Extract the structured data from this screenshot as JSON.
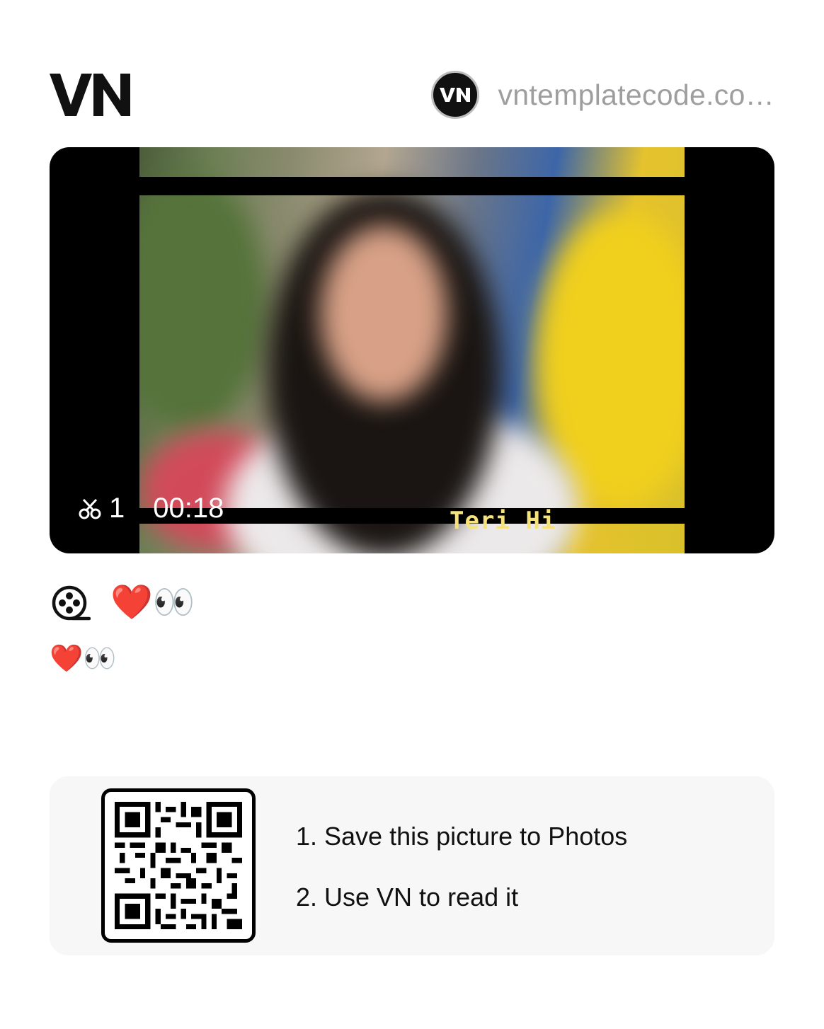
{
  "header": {
    "logo_text": "VN",
    "avatar_text": "VN",
    "author_name": "vntemplatecode.co…"
  },
  "video": {
    "overlay_caption": "Teri  Hi",
    "clip_count": "1",
    "duration": "00:18",
    "icons": {
      "clips": "scissors-icon"
    }
  },
  "template": {
    "type_icon": "film-reel-icon",
    "title": "❤️👀",
    "description": "❤️👀"
  },
  "qr": {
    "step1": "1. Save this picture to Photos",
    "step2": "2. Use VN to read it"
  }
}
